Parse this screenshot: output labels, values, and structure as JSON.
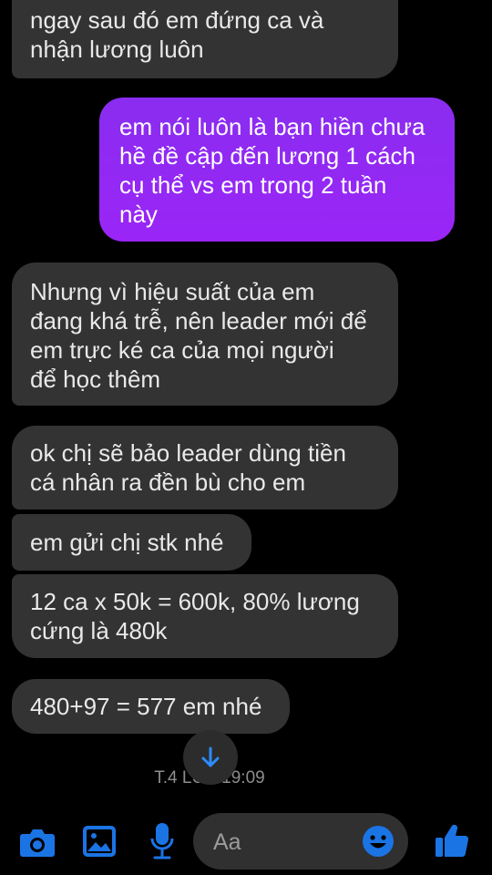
{
  "messages": [
    {
      "side": "received",
      "text": "ngay sau đó em đứng ca và\nnhận lương luôn"
    },
    {
      "side": "sent",
      "text": "em nói luôn là bạn hiền chưa\nhề đề cập đến lương 1 cách\ncụ thể vs em trong 2 tuần\nnày"
    },
    {
      "side": "received",
      "text": "Nhưng vì hiệu suất của em\nđang khá trễ, nên leader mới để\nem trực ké ca của mọi người\nđể học thêm"
    },
    {
      "side": "received",
      "text": "ok chị sẽ bảo leader dùng tiền\ncá nhân ra đền bù cho em"
    },
    {
      "side": "received",
      "text": "em gửi chị stk nhé"
    },
    {
      "side": "received",
      "text": "12 ca x 50k = 600k, 80% lương\ncứng là 480k"
    },
    {
      "side": "received",
      "text": "480+97 = 577 em nhé"
    }
  ],
  "timestamp": "T.4 LÚC 19:09",
  "composer": {
    "placeholder": "Aa"
  },
  "colors": {
    "accent": "#1b74e4",
    "sent_bubble": "#8f29f4",
    "received_bubble": "#333334"
  },
  "icons": [
    "camera-icon",
    "image-icon",
    "microphone-icon",
    "scroll-down-arrow-icon",
    "emoji-icon",
    "thumbs-up-icon"
  ]
}
